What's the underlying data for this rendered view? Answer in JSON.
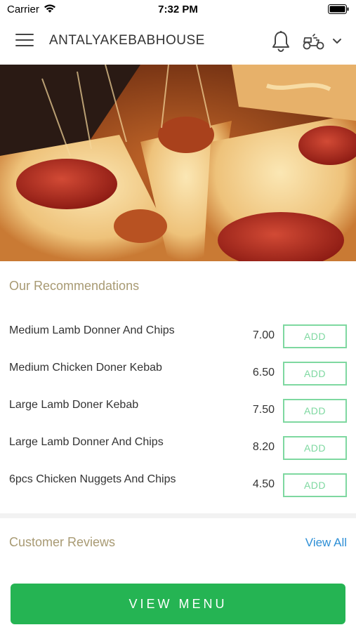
{
  "status_bar": {
    "carrier": "Carrier",
    "time": "7:32 PM"
  },
  "header": {
    "title": "ANTALYAKEBABHOUSE",
    "menu_icon": "hamburger-icon",
    "bell_icon": "bell-icon",
    "delivery_icon": "scooter-icon",
    "dropdown_icon": "chevron-down-icon"
  },
  "hero": {
    "image": "pepperoni-pizza-photo"
  },
  "recommendations": {
    "title": "Our Recommendations",
    "add_label": "ADD",
    "items": [
      {
        "name": "Medium Lamb Donner And Chips",
        "price": "7.00"
      },
      {
        "name": "Medium Chicken Doner Kebab",
        "price": "6.50"
      },
      {
        "name": "Large Lamb Doner Kebab",
        "price": "7.50"
      },
      {
        "name": "Large Lamb Donner And Chips",
        "price": "8.20"
      },
      {
        "name": "6pcs Chicken Nuggets And Chips",
        "price": "4.50"
      }
    ]
  },
  "reviews": {
    "title": "Customer Reviews",
    "view_all": "View All"
  },
  "footer": {
    "view_menu": "VIEW MENU"
  },
  "colors": {
    "accent_green": "#25b453",
    "add_border": "#7ed8a0",
    "section_title": "#a89a73",
    "link_blue": "#2e8fd6"
  }
}
